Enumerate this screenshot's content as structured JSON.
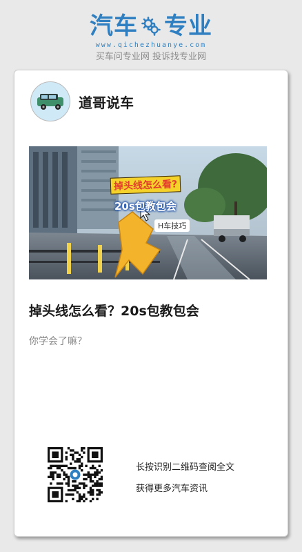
{
  "brand": {
    "logo_left": "汽车",
    "logo_right": "专业",
    "logo_icon": "gears-icon",
    "domain": "www.qichezhuanye.com",
    "slogan": "买车问专业网 投诉找专业网",
    "color": "#2f7fc1"
  },
  "author": {
    "avatar_icon": "car-avatar-icon",
    "name": "道哥说车"
  },
  "cover": {
    "overlay_title": "掉头线怎么看?",
    "overlay_subtitle": "20s包教包会",
    "overlay_chip": "H车技巧"
  },
  "article": {
    "title": "掉头线怎么看？20s包教包会",
    "description": "你学会了嘛？"
  },
  "qr": {
    "icon": "qr-code-icon",
    "line1": "长按识别二维码查阅全文",
    "line2": "获得更多汽车资讯"
  }
}
